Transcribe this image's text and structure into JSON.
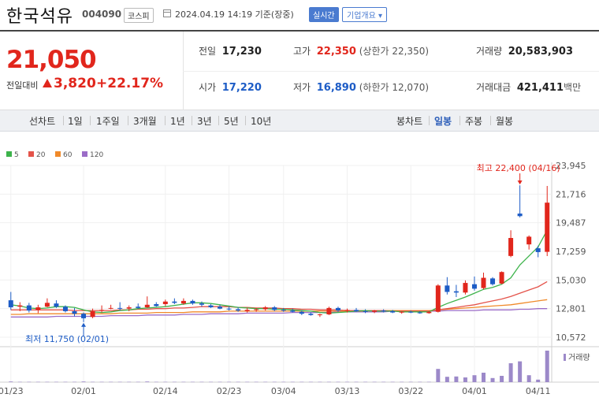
{
  "header": {
    "name": "한국석유",
    "code": "004090",
    "market": "코스피",
    "datetime": "2024.04.19 14:19  기준(장중)",
    "live": "실시간",
    "company": "기업개요 ▾"
  },
  "summary": {
    "price": "21,050",
    "change_label": "전일대비",
    "change": "3,820",
    "change_pct": "+22.17%",
    "prev_label": "전일",
    "prev": "17,230",
    "open_label": "시가",
    "open": "17,220",
    "high_label": "고가",
    "high": "22,350",
    "high_limit": "(상한가 22,350)",
    "low_label": "저가",
    "low": "16,890",
    "low_limit": "(하한가 12,070)",
    "volume_label": "거래량",
    "volume": "20,583,903",
    "amount_label": "거래대금",
    "amount": "421,411",
    "amount_unit": "백만"
  },
  "toolbar": {
    "line_label": "선차트",
    "periods": [
      "1일",
      "1주일",
      "3개월",
      "1년",
      "3년",
      "5년",
      "10년"
    ],
    "candle_label": "봉차트",
    "candles": [
      "일봉",
      "주봉",
      "월봉"
    ],
    "selected_candle": "일봉"
  },
  "chart_data": {
    "type": "candlestick",
    "ma_legend": [
      {
        "name": "5",
        "color": "#3db34b"
      },
      {
        "name": "20",
        "color": "#e4534a"
      },
      {
        "name": "60",
        "color": "#f08a2a"
      },
      {
        "name": "120",
        "color": "#9b6cc7"
      }
    ],
    "y_ticks": [
      "23,945",
      "21,716",
      "19,487",
      "17,259",
      "15,030",
      "12,801",
      "10,572"
    ],
    "ylim": [
      10572,
      23945
    ],
    "x_ticks": [
      "01/23",
      "02/01",
      "02/14",
      "02/23",
      "03/04",
      "03/13",
      "03/22",
      "04/01",
      "04/11"
    ],
    "max_note": "최고 22,400 (04/16)",
    "min_note": "최저 11,750 (02/01)",
    "volume_label": "거래량",
    "candles": [
      {
        "o": 13450,
        "h": 14100,
        "l": 12700,
        "c": 12900
      },
      {
        "o": 12950,
        "h": 13300,
        "l": 12600,
        "c": 13050
      },
      {
        "o": 13050,
        "h": 13250,
        "l": 12500,
        "c": 12650
      },
      {
        "o": 12700,
        "h": 13100,
        "l": 12450,
        "c": 12900
      },
      {
        "o": 12950,
        "h": 13600,
        "l": 12900,
        "c": 13250
      },
      {
        "o": 13200,
        "h": 13450,
        "l": 12850,
        "c": 12950
      },
      {
        "o": 12950,
        "h": 13050,
        "l": 12500,
        "c": 12600
      },
      {
        "o": 12600,
        "h": 12850,
        "l": 12200,
        "c": 12400
      },
      {
        "o": 12400,
        "h": 12500,
        "l": 11750,
        "c": 12050
      },
      {
        "o": 12150,
        "h": 12800,
        "l": 12050,
        "c": 12600
      },
      {
        "o": 12650,
        "h": 13050,
        "l": 12500,
        "c": 12700
      },
      {
        "o": 12800,
        "h": 13100,
        "l": 12750,
        "c": 12850
      },
      {
        "o": 12850,
        "h": 13300,
        "l": 12650,
        "c": 12800
      },
      {
        "o": 12800,
        "h": 13050,
        "l": 12600,
        "c": 12900
      },
      {
        "o": 12950,
        "h": 13200,
        "l": 12800,
        "c": 12850
      },
      {
        "o": 12900,
        "h": 13750,
        "l": 12850,
        "c": 13100
      },
      {
        "o": 13150,
        "h": 13300,
        "l": 12950,
        "c": 13000
      },
      {
        "o": 13150,
        "h": 13500,
        "l": 13000,
        "c": 13350
      },
      {
        "o": 13350,
        "h": 13600,
        "l": 13150,
        "c": 13250
      },
      {
        "o": 13200,
        "h": 13600,
        "l": 13100,
        "c": 13400
      },
      {
        "o": 13400,
        "h": 13500,
        "l": 13100,
        "c": 13200
      },
      {
        "o": 13200,
        "h": 13350,
        "l": 12950,
        "c": 13100
      },
      {
        "o": 13050,
        "h": 13150,
        "l": 12850,
        "c": 12900
      },
      {
        "o": 12950,
        "h": 13100,
        "l": 12750,
        "c": 12800
      },
      {
        "o": 12800,
        "h": 12950,
        "l": 12650,
        "c": 12750
      },
      {
        "o": 12750,
        "h": 12900,
        "l": 12550,
        "c": 12650
      },
      {
        "o": 12600,
        "h": 12850,
        "l": 12500,
        "c": 12700
      },
      {
        "o": 12700,
        "h": 12850,
        "l": 12550,
        "c": 12750
      },
      {
        "o": 12750,
        "h": 13000,
        "l": 12650,
        "c": 12900
      },
      {
        "o": 12900,
        "h": 13000,
        "l": 12600,
        "c": 12700
      },
      {
        "o": 12700,
        "h": 12850,
        "l": 12550,
        "c": 12650
      },
      {
        "o": 12650,
        "h": 12800,
        "l": 12500,
        "c": 12550
      },
      {
        "o": 12550,
        "h": 12650,
        "l": 12300,
        "c": 12400
      },
      {
        "o": 12400,
        "h": 12500,
        "l": 12250,
        "c": 12300
      },
      {
        "o": 12300,
        "h": 12400,
        "l": 12150,
        "c": 12350
      },
      {
        "o": 12350,
        "h": 12950,
        "l": 12300,
        "c": 12850
      },
      {
        "o": 12850,
        "h": 12950,
        "l": 12550,
        "c": 12650
      },
      {
        "o": 12650,
        "h": 12800,
        "l": 12500,
        "c": 12700
      },
      {
        "o": 12700,
        "h": 12850,
        "l": 12550,
        "c": 12600
      },
      {
        "o": 12600,
        "h": 12750,
        "l": 12450,
        "c": 12550
      },
      {
        "o": 12550,
        "h": 12700,
        "l": 12450,
        "c": 12650
      },
      {
        "o": 12650,
        "h": 12750,
        "l": 12500,
        "c": 12600
      },
      {
        "o": 12600,
        "h": 12700,
        "l": 12450,
        "c": 12500
      },
      {
        "o": 12500,
        "h": 12600,
        "l": 12400,
        "c": 12550
      },
      {
        "o": 12550,
        "h": 12650,
        "l": 12450,
        "c": 12500
      },
      {
        "o": 12500,
        "h": 12600,
        "l": 12400,
        "c": 12450
      },
      {
        "o": 12450,
        "h": 12600,
        "l": 12400,
        "c": 12550
      },
      {
        "o": 12550,
        "h": 14700,
        "l": 12500,
        "c": 14600
      },
      {
        "o": 14600,
        "h": 15250,
        "l": 13900,
        "c": 14100
      },
      {
        "o": 14150,
        "h": 14650,
        "l": 13700,
        "c": 14050
      },
      {
        "o": 14050,
        "h": 15000,
        "l": 13900,
        "c": 14800
      },
      {
        "o": 14700,
        "h": 15300,
        "l": 14200,
        "c": 14350
      },
      {
        "o": 14400,
        "h": 15600,
        "l": 14300,
        "c": 15200
      },
      {
        "o": 15150,
        "h": 15250,
        "l": 14600,
        "c": 14700
      },
      {
        "o": 14750,
        "h": 15700,
        "l": 14700,
        "c": 15650
      },
      {
        "o": 16900,
        "h": 18900,
        "l": 16800,
        "c": 18300
      },
      {
        "o": 20200,
        "h": 22400,
        "l": 19900,
        "c": 20000
      },
      {
        "o": 17800,
        "h": 18500,
        "l": 17400,
        "c": 18400
      },
      {
        "o": 17500,
        "h": 17700,
        "l": 16800,
        "c": 17200
      },
      {
        "o": 17220,
        "h": 22350,
        "l": 16890,
        "c": 21050
      }
    ],
    "volumes": [
      0.02,
      0.01,
      0.01,
      0.01,
      0.01,
      0.01,
      0.01,
      0.01,
      0.02,
      0.01,
      0.01,
      0.01,
      0.01,
      0.01,
      0.01,
      0.02,
      0.01,
      0.01,
      0.01,
      0.01,
      0.01,
      0.01,
      0.01,
      0.01,
      0.01,
      0.01,
      0.01,
      0.01,
      0.01,
      0.01,
      0.01,
      0.01,
      0.01,
      0.01,
      0.01,
      0.01,
      0.01,
      0.01,
      0.01,
      0.01,
      0.01,
      0.01,
      0.01,
      0.01,
      0.01,
      0.01,
      0.01,
      0.42,
      0.17,
      0.18,
      0.15,
      0.22,
      0.3,
      0.13,
      0.2,
      0.6,
      0.66,
      0.22,
      0.08,
      1.0
    ],
    "ma": {
      "5": [
        13100,
        13000,
        12850,
        12800,
        12850,
        12950,
        12950,
        12900,
        12700,
        12550,
        12500,
        12550,
        12650,
        12700,
        12800,
        12850,
        12900,
        12950,
        13050,
        13150,
        13250,
        13250,
        13200,
        13100,
        13000,
        12900,
        12850,
        12800,
        12800,
        12750,
        12750,
        12700,
        12650,
        12600,
        12500,
        12450,
        12500,
        12550,
        12600,
        12650,
        12600,
        12600,
        12600,
        12550,
        12550,
        12550,
        12550,
        12900,
        13200,
        13450,
        13700,
        14000,
        14300,
        14450,
        14700,
        15200,
        16200,
        16900,
        17600,
        18900
      ],
      "20": [
        12700,
        12700,
        12700,
        12700,
        12700,
        12700,
        12700,
        12650,
        12650,
        12650,
        12650,
        12650,
        12700,
        12700,
        12750,
        12750,
        12800,
        12800,
        12850,
        12850,
        12900,
        12950,
        12950,
        12950,
        12950,
        12900,
        12900,
        12850,
        12850,
        12850,
        12800,
        12800,
        12750,
        12750,
        12700,
        12700,
        12700,
        12650,
        12650,
        12650,
        12650,
        12650,
        12600,
        12600,
        12600,
        12600,
        12600,
        12700,
        12800,
        12900,
        13000,
        13100,
        13250,
        13400,
        13550,
        13750,
        14000,
        14250,
        14500,
        14900
      ],
      "60": [
        12350,
        12350,
        12400,
        12400,
        12400,
        12400,
        12400,
        12400,
        12400,
        12400,
        12400,
        12400,
        12450,
        12450,
        12450,
        12450,
        12500,
        12500,
        12500,
        12500,
        12550,
        12550,
        12550,
        12550,
        12600,
        12600,
        12600,
        12600,
        12600,
        12600,
        12600,
        12600,
        12600,
        12600,
        12600,
        12600,
        12600,
        12600,
        12600,
        12600,
        12650,
        12650,
        12650,
        12650,
        12650,
        12650,
        12650,
        12700,
        12750,
        12800,
        12850,
        12900,
        12950,
        13000,
        13050,
        13100,
        13200,
        13300,
        13400,
        13500
      ],
      "120": [
        12150,
        12150,
        12150,
        12150,
        12150,
        12200,
        12200,
        12200,
        12200,
        12200,
        12200,
        12250,
        12250,
        12250,
        12250,
        12300,
        12300,
        12300,
        12300,
        12350,
        12350,
        12350,
        12400,
        12400,
        12400,
        12400,
        12450,
        12450,
        12450,
        12450,
        12450,
        12500,
        12500,
        12500,
        12500,
        12500,
        12550,
        12550,
        12550,
        12550,
        12550,
        12550,
        12600,
        12600,
        12600,
        12600,
        12600,
        12600,
        12650,
        12650,
        12650,
        12650,
        12700,
        12700,
        12700,
        12700,
        12750,
        12750,
        12800,
        12800
      ]
    }
  }
}
